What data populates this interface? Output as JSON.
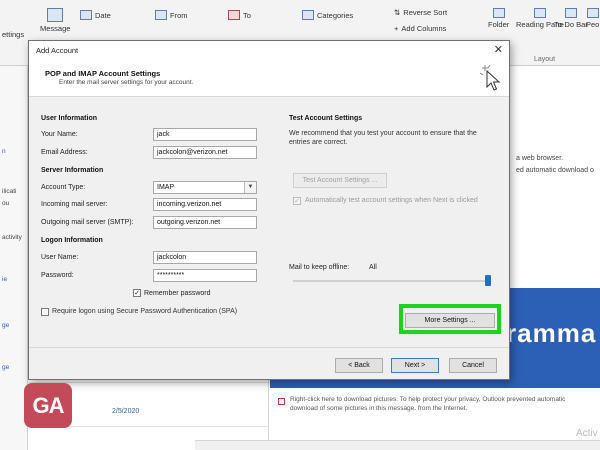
{
  "ribbon": {
    "settings_label": "ettings",
    "message_label": "Message",
    "date_label": "Date",
    "from_label": "From",
    "to_label": "To",
    "categories_label": "Categories",
    "reverse_sort_label": "Reverse Sort",
    "add_columns_label": "Add Columns",
    "folder_label": "Folder",
    "reading_pane_label": "Reading Pane",
    "todo_bar_label": "To-Do Bar",
    "people_label": "Peo",
    "layout_label": "Layout"
  },
  "left_pane": {
    "items": [
      "n",
      "ilicati",
      "ou",
      "activity",
      "ie",
      "ge",
      "ge"
    ]
  },
  "message_list": {
    "date": "2/5/2020"
  },
  "reading_pane": {
    "browser_text": "a web browser.",
    "download_text": "ed automatic download o",
    "banner_text": "ramma",
    "picture_notice": "Right-click here to download pictures. To help protect your privacy, Outlook prevented automatic download of some pictures in this message. from the Internet.",
    "watermark": "Activ"
  },
  "logo": {
    "text": "GA",
    "color": "#c24a59"
  },
  "dialog": {
    "title": "Add Account",
    "header_title": "POP and IMAP Account Settings",
    "header_subtitle": "Enter the mail server settings for your account.",
    "user_info": {
      "title": "User Information",
      "name_label": "Your Name:",
      "name_value": "jack",
      "email_label": "Email Address:",
      "email_value": "jackcolon@verizon.net"
    },
    "server_info": {
      "title": "Server Information",
      "account_type_label": "Account Type:",
      "account_type_value": "IMAP",
      "incoming_label": "Incoming mail server:",
      "incoming_value": "incoming.verizon.net",
      "outgoing_label": "Outgoing mail server (SMTP):",
      "outgoing_value": "outgoing.verizon.net"
    },
    "logon_info": {
      "title": "Logon Information",
      "username_label": "User Name:",
      "username_value": "jackcolon",
      "password_label": "Password:",
      "password_value": "**********",
      "remember_label": "Remember password",
      "remember_checked": true,
      "spa_label": "Require logon using Secure Password Authentication (SPA)",
      "spa_checked": false
    },
    "test_settings": {
      "title": "Test Account Settings",
      "description": "We recommend that you test your account to ensure that the entries are correct.",
      "test_button": "Test Account Settings ...",
      "auto_test_label": "Automatically test account settings when Next is clicked",
      "mail_offline_label": "Mail to keep offline:",
      "mail_offline_value": "All",
      "mail_offline_level": 1.0
    },
    "more_settings_button": "More Settings ...",
    "back_button": "< Back",
    "next_button": "Next >",
    "cancel_button": "Cancel",
    "highlight_color": "#1dd21d"
  }
}
